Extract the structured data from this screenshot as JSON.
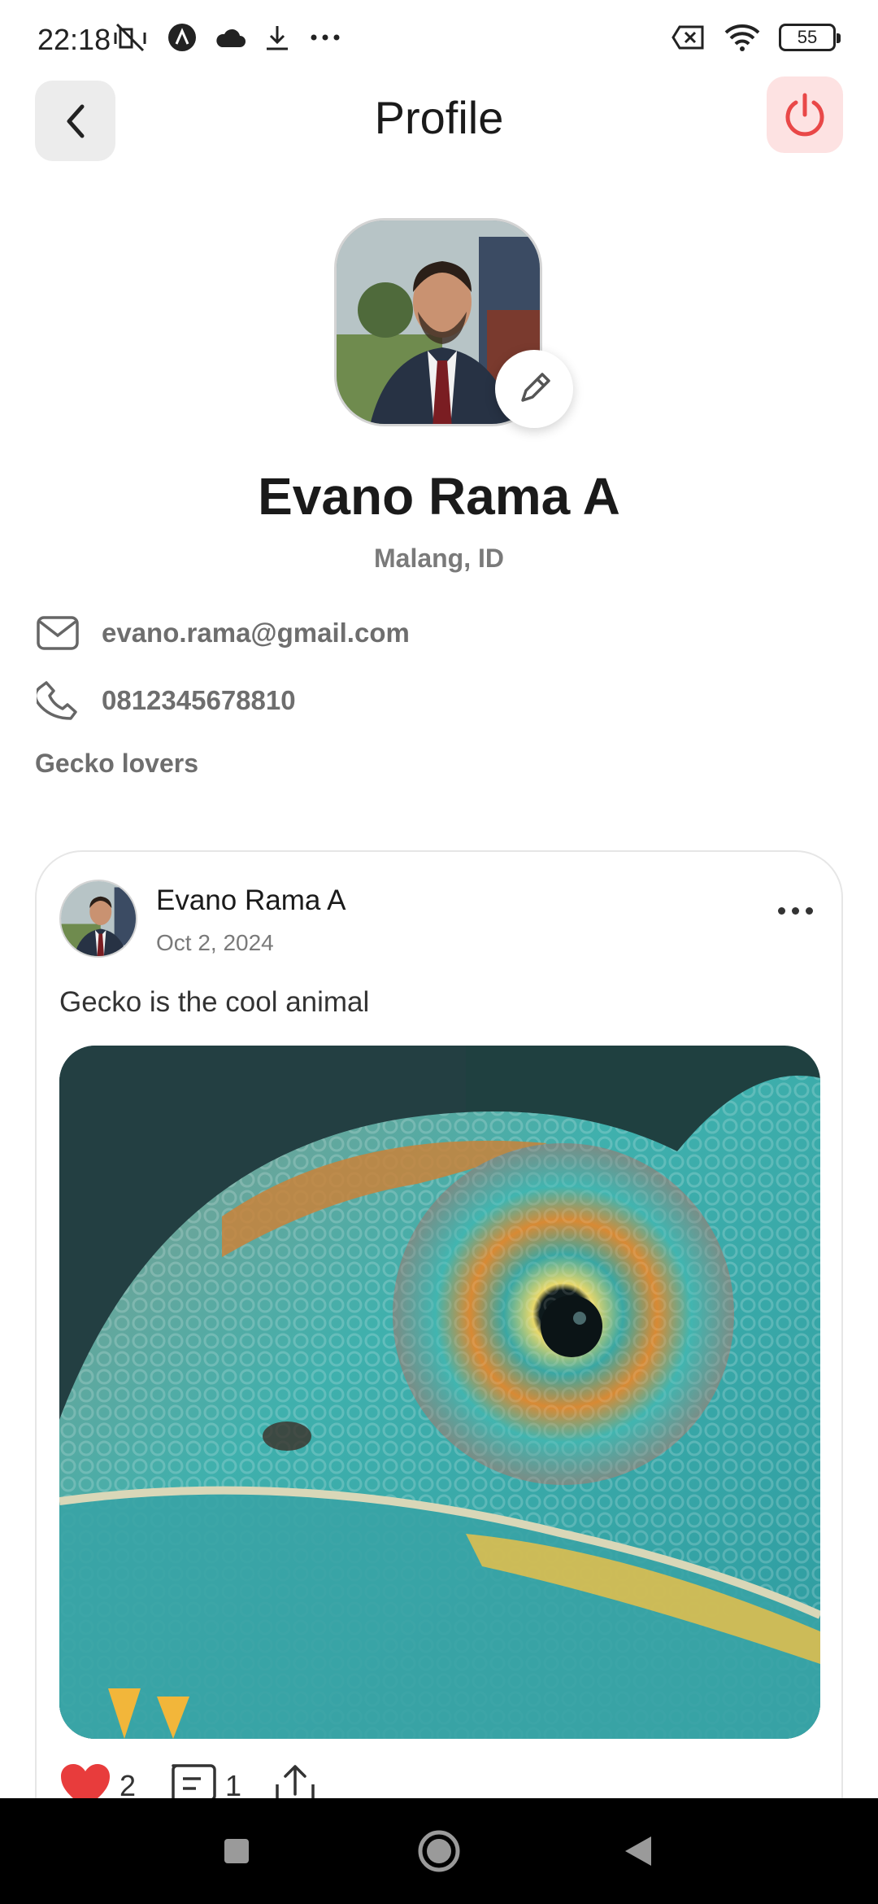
{
  "status_bar": {
    "time": "22:18",
    "left_icons": [
      "muted-vibrate-icon",
      "a-app-icon",
      "cloud-icon",
      "download-icon",
      "more-dots-icon"
    ],
    "right_icons": [
      "sim-off-icon",
      "wifi-icon",
      "battery-icon"
    ],
    "battery_level": "55"
  },
  "header": {
    "title": "Profile",
    "back_icon": "chevron-left-icon",
    "power_icon": "power-icon",
    "power_color": "#e94848"
  },
  "profile": {
    "name": "Evano Rama A",
    "location": "Malang, ID",
    "email": "evano.rama@gmail.com",
    "phone": "0812345678810",
    "bio": "Gecko lovers",
    "edit_icon": "pencil-icon"
  },
  "post": {
    "author": "Evano Rama A",
    "date": "Oct 2, 2024",
    "caption": "Gecko is the cool animal",
    "likes": "2",
    "comments": "1",
    "like_color": "#e83c3c"
  },
  "nav": {
    "recent_icon": "square-icon",
    "home_icon": "circle-icon",
    "back_icon": "triangle-back-icon"
  }
}
